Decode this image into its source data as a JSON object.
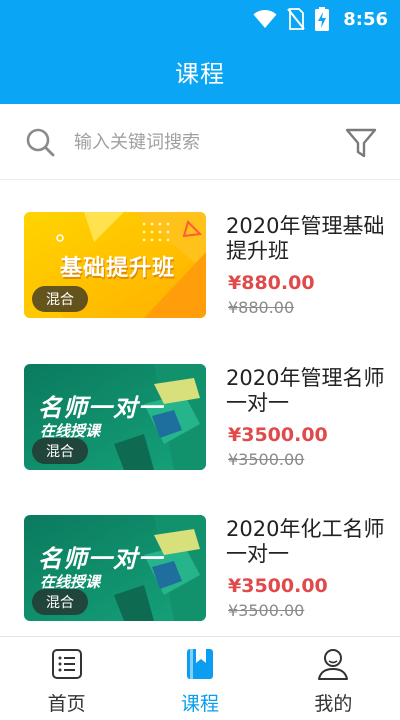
{
  "status_bar": {
    "time": "8:56"
  },
  "header": {
    "title": "课程"
  },
  "search": {
    "placeholder": "输入关键词搜索"
  },
  "courses": [
    {
      "title": "2020年管理基础提升班",
      "price": "¥880.00",
      "original_price": "¥880.00",
      "tag": "混合",
      "banner_text": "基础提升班"
    },
    {
      "title": "2020年管理名师一对一",
      "price": "¥3500.00",
      "original_price": "¥3500.00",
      "tag": "混合",
      "banner_text": "名师一对一",
      "banner_subtext": "在线授课"
    },
    {
      "title": "2020年化工名师一对一",
      "price": "¥3500.00",
      "original_price": "¥3500.00",
      "tag": "混合",
      "banner_text": "名师一对一",
      "banner_subtext": "在线授课"
    }
  ],
  "bottom_nav": {
    "items": [
      {
        "label": "首页",
        "icon": "list-icon",
        "active": false
      },
      {
        "label": "课程",
        "icon": "bookmark-book-icon",
        "active": true
      },
      {
        "label": "我的",
        "icon": "user-icon",
        "active": false
      }
    ]
  },
  "colors": {
    "primary": "#0aa6f5",
    "price": "#e04a4a",
    "active_nav": "#0a9df0"
  }
}
